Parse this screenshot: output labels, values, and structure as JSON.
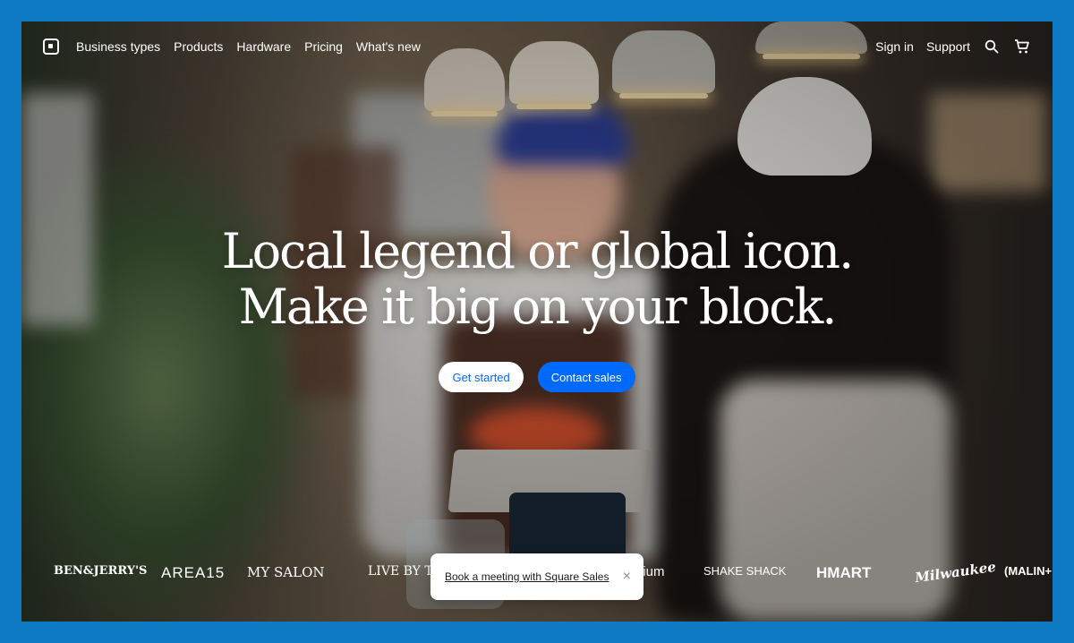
{
  "header": {
    "nav_left": [
      "Business types",
      "Products",
      "Hardware",
      "Pricing",
      "What's new"
    ],
    "nav_right": [
      "Sign in",
      "Support"
    ],
    "icons": [
      "square-logo-icon",
      "search-icon",
      "cart-icon"
    ]
  },
  "hero": {
    "line1": "Local legend or global icon.",
    "line2": "Make it big on your block.",
    "get_started": "Get started",
    "contact_sales": "Contact sales"
  },
  "logos": [
    "BEN&JERRY'S",
    "AREA15",
    "MY SALON",
    "LIVE BY THE SU",
    "dium",
    "SHAKE SHACK",
    "HMART",
    "Milwaukee",
    "(MALIN+"
  ],
  "toast": {
    "link": "Book a meeting with Square Sales",
    "close": "×"
  },
  "colors": {
    "page_frame": "#0e7ac4",
    "primary_blue": "#006aff",
    "white": "#ffffff"
  }
}
